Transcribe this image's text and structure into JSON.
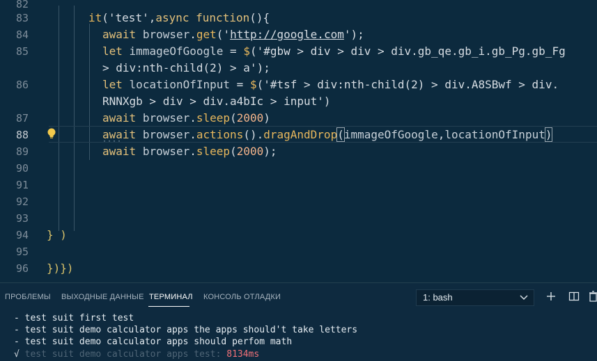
{
  "editor": {
    "lines": [
      {
        "n": "82",
        "text": ""
      },
      {
        "n": "83",
        "text": "it('test',async function(){"
      },
      {
        "n": "84",
        "text": "await browser.get('http://google.com');"
      },
      {
        "n": "85",
        "text": "let immageOfGoogle = $('#gbw > div > div > div.gb_qe.gb_i.gb_Pg.gb_Fg"
      },
      {
        "n": "",
        "text": "> div:nth-child(2) > a');"
      },
      {
        "n": "86",
        "text": "let locationOfInput = $('#tsf > div:nth-child(2) > div.A8SBwf > div."
      },
      {
        "n": "",
        "text": "RNNXgb > div > div.a4bIc > input')"
      },
      {
        "n": "87",
        "text": "await browser.sleep(2000)"
      },
      {
        "n": "88",
        "text": "await browser.actions().dragAndDrop(immageOfGoogle,locationOfInput)"
      },
      {
        "n": "89",
        "text": "await browser.sleep(2000);"
      },
      {
        "n": "90",
        "text": ""
      },
      {
        "n": "91",
        "text": ""
      },
      {
        "n": "92",
        "text": ""
      },
      {
        "n": "93",
        "text": ""
      },
      {
        "n": "94",
        "text": "} )"
      },
      {
        "n": "95",
        "text": ""
      },
      {
        "n": "96",
        "text": "})})"
      }
    ],
    "lightbulb_icon": "lightbulb-icon"
  },
  "panel": {
    "tabs": [
      {
        "label": "ПРОБЛЕМЫ"
      },
      {
        "label": "ВЫХОДНЫЕ ДАННЫЕ"
      },
      {
        "label": "ТЕРМИНАЛ",
        "active": true
      },
      {
        "label": "КОНСОЛЬ ОТЛАДКИ"
      }
    ],
    "terminal_select": "1: bash",
    "icons": [
      "plus-icon",
      "split-icon",
      "trash-icon"
    ],
    "terminal_output": [
      "- test suit first test",
      "- test suit demo calculator apps the apps should't take letters",
      "- test suit demo calculator apps should perfom math"
    ],
    "last_line": {
      "check": "√",
      "text": "test suit demo calculator apps test:",
      "time": "8134ms"
    }
  },
  "colors": {
    "editor_bg": "#0c2a3e",
    "panel_bg": "#0e2a3f",
    "accent_string": "#e7b75c",
    "number": "#f2b38a"
  }
}
